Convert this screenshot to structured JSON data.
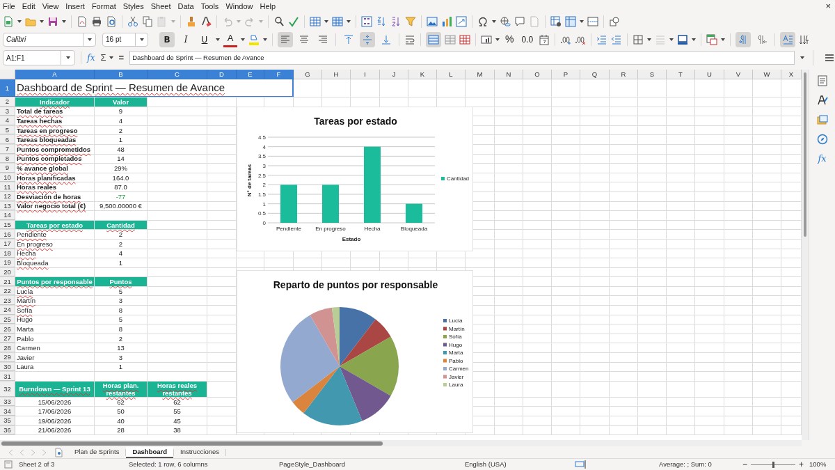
{
  "menu": {
    "items": [
      "File",
      "Edit",
      "View",
      "Insert",
      "Format",
      "Styles",
      "Sheet",
      "Data",
      "Tools",
      "Window",
      "Help"
    ],
    "close_label": "×"
  },
  "toolbar": {
    "disabled": {
      "paste": true,
      "undo": true,
      "redo": true,
      "header_footer": true
    }
  },
  "format_toolbar": {
    "font_name": "Calibri",
    "font_size": "16 pt",
    "buttons": [
      {
        "label": "B",
        "on": true
      },
      {
        "label": "I",
        "on": false
      },
      {
        "label": "U",
        "on": false
      }
    ],
    "font_color_label": "A",
    "number_labels": [
      "%",
      "0.0"
    ],
    "horizontal_align": {
      "left": true,
      "center": false,
      "right": false
    },
    "vertical_align": {
      "top": false,
      "middle": true,
      "bottom": false
    },
    "merged": true,
    "left_to_right": true,
    "right_to_left": false,
    "text_flow": true
  },
  "formula_bar": {
    "name_box": "A1:F1",
    "buttons": [
      "fx",
      "Σ",
      "="
    ],
    "content": "Dashboard de Sprint — Resumen de Avance"
  },
  "sidebar": {
    "functions_label": "fx"
  },
  "columns": [
    {
      "label": "A",
      "selected": true
    },
    {
      "label": "B",
      "selected": true
    },
    {
      "label": "C",
      "selected": true
    },
    {
      "label": "D",
      "selected": true
    },
    {
      "label": "E",
      "selected": true
    },
    {
      "label": "F",
      "selected": true
    },
    {
      "label": "G",
      "selected": false
    },
    {
      "label": "H",
      "selected": false
    },
    {
      "label": "I",
      "selected": false
    },
    {
      "label": "J",
      "selected": false
    },
    {
      "label": "K",
      "selected": false
    },
    {
      "label": "L",
      "selected": false
    },
    {
      "label": "M",
      "selected": false
    },
    {
      "label": "N",
      "selected": false
    },
    {
      "label": "O",
      "selected": false
    },
    {
      "label": "P",
      "selected": false
    },
    {
      "label": "Q",
      "selected": false
    },
    {
      "label": "R",
      "selected": false
    },
    {
      "label": "S",
      "selected": false
    },
    {
      "label": "T",
      "selected": false
    },
    {
      "label": "U",
      "selected": false
    },
    {
      "label": "V",
      "selected": false
    },
    {
      "label": "W",
      "selected": false
    },
    {
      "label": "X",
      "selected": false
    }
  ],
  "rows": [
    {
      "number": "1",
      "selected": true,
      "cells": [
        {
          "text": "Dashboard de Sprint — Resumen de Avance",
          "kind": "title",
          "misspelled": true
        }
      ]
    },
    {
      "number": "2",
      "selected": false,
      "cells": [
        {
          "text": "Indicador",
          "kind": "header",
          "misspelled": true
        },
        {
          "text": "Valor",
          "kind": "header",
          "misspelled": false
        }
      ]
    },
    {
      "number": "3",
      "selected": false,
      "cells": [
        {
          "text": "Total de tareas",
          "kind": "strong",
          "misspelled": true
        },
        {
          "text": "9",
          "kind": "value",
          "misspelled": false
        }
      ]
    },
    {
      "number": "4",
      "selected": false,
      "cells": [
        {
          "text": "Tareas hechas",
          "kind": "strong",
          "misspelled": true
        },
        {
          "text": "4",
          "kind": "value",
          "misspelled": false
        }
      ]
    },
    {
      "number": "5",
      "selected": false,
      "cells": [
        {
          "text": "Tareas en progreso",
          "kind": "strong",
          "misspelled": true
        },
        {
          "text": "2",
          "kind": "value",
          "misspelled": false
        }
      ]
    },
    {
      "number": "6",
      "selected": false,
      "cells": [
        {
          "text": "Tareas bloqueadas",
          "kind": "strong",
          "misspelled": true
        },
        {
          "text": "1",
          "kind": "value",
          "misspelled": false
        }
      ]
    },
    {
      "number": "7",
      "selected": false,
      "cells": [
        {
          "text": "Puntos comprometidos",
          "kind": "strong",
          "misspelled": true
        },
        {
          "text": "48",
          "kind": "value",
          "misspelled": false
        }
      ]
    },
    {
      "number": "8",
      "selected": false,
      "cells": [
        {
          "text": "Puntos completados",
          "kind": "strong",
          "misspelled": true
        },
        {
          "text": "14",
          "kind": "value",
          "misspelled": false
        }
      ]
    },
    {
      "number": "9",
      "selected": false,
      "cells": [
        {
          "text": "% avance global",
          "kind": "strong",
          "misspelled": true
        },
        {
          "text": "29%",
          "kind": "value",
          "misspelled": false
        }
      ]
    },
    {
      "number": "10",
      "selected": false,
      "cells": [
        {
          "text": "Horas planificadas",
          "kind": "strong",
          "misspelled": true
        },
        {
          "text": "164.0",
          "kind": "value",
          "misspelled": false
        }
      ]
    },
    {
      "number": "11",
      "selected": false,
      "cells": [
        {
          "text": "Horas reales",
          "kind": "strong",
          "misspelled": true
        },
        {
          "text": "87.0",
          "kind": "value",
          "misspelled": false
        }
      ]
    },
    {
      "number": "12",
      "selected": false,
      "cells": [
        {
          "text": "Desviación de horas",
          "kind": "strong",
          "misspelled": true
        },
        {
          "text": "-77",
          "kind": "good",
          "misspelled": false
        }
      ]
    },
    {
      "number": "13",
      "selected": false,
      "cells": [
        {
          "text": "Valor negocio total (€)",
          "kind": "strong",
          "misspelled": true
        },
        {
          "text": "9,500.00000 €",
          "kind": "value",
          "misspelled": false
        }
      ]
    },
    {
      "number": "14",
      "selected": false,
      "cells": []
    },
    {
      "number": "15",
      "selected": false,
      "cells": [
        {
          "text": "Tareas por estado",
          "kind": "header",
          "misspelled": true
        },
        {
          "text": "Cantidad",
          "kind": "header",
          "misspelled": true
        }
      ]
    },
    {
      "number": "16",
      "selected": false,
      "cells": [
        {
          "text": "Pendiente",
          "kind": "label",
          "misspelled": true
        },
        {
          "text": "2",
          "kind": "value",
          "misspelled": false
        }
      ]
    },
    {
      "number": "17",
      "selected": false,
      "cells": [
        {
          "text": "En progreso",
          "kind": "label",
          "misspelled": true
        },
        {
          "text": "2",
          "kind": "value",
          "misspelled": false
        }
      ]
    },
    {
      "number": "18",
      "selected": false,
      "cells": [
        {
          "text": "Hecha",
          "kind": "label",
          "misspelled": true
        },
        {
          "text": "4",
          "kind": "value",
          "misspelled": false
        }
      ]
    },
    {
      "number": "19",
      "selected": false,
      "cells": [
        {
          "text": "Bloqueada",
          "kind": "label",
          "misspelled": true
        },
        {
          "text": "1",
          "kind": "value",
          "misspelled": false
        }
      ]
    },
    {
      "number": "20",
      "selected": false,
      "cells": []
    },
    {
      "number": "21",
      "selected": false,
      "cells": [
        {
          "text": "Puntos por responsable",
          "kind": "header",
          "misspelled": true
        },
        {
          "text": "Puntos",
          "kind": "header",
          "misspelled": true
        }
      ]
    },
    {
      "number": "22",
      "selected": false,
      "cells": [
        {
          "text": "Lucía",
          "kind": "label",
          "misspelled": true
        },
        {
          "text": "5",
          "kind": "value",
          "misspelled": false
        }
      ]
    },
    {
      "number": "23",
      "selected": false,
      "cells": [
        {
          "text": "Martín",
          "kind": "label",
          "misspelled": true
        },
        {
          "text": "3",
          "kind": "value",
          "misspelled": false
        }
      ]
    },
    {
      "number": "24",
      "selected": false,
      "cells": [
        {
          "text": "Sofía",
          "kind": "label",
          "misspelled": true
        },
        {
          "text": "8",
          "kind": "value",
          "misspelled": false
        }
      ]
    },
    {
      "number": "25",
      "selected": false,
      "cells": [
        {
          "text": "Hugo",
          "kind": "label",
          "misspelled": false
        },
        {
          "text": "5",
          "kind": "value",
          "misspelled": false
        }
      ]
    },
    {
      "number": "26",
      "selected": false,
      "cells": [
        {
          "text": "Marta",
          "kind": "label",
          "misspelled": false
        },
        {
          "text": "8",
          "kind": "value",
          "misspelled": false
        }
      ]
    },
    {
      "number": "27",
      "selected": false,
      "cells": [
        {
          "text": "Pablo",
          "kind": "label",
          "misspelled": false
        },
        {
          "text": "2",
          "kind": "value",
          "misspelled": false
        }
      ]
    },
    {
      "number": "28",
      "selected": false,
      "cells": [
        {
          "text": "Carmen",
          "kind": "label",
          "misspelled": false
        },
        {
          "text": "13",
          "kind": "value",
          "misspelled": false
        }
      ]
    },
    {
      "number": "29",
      "selected": false,
      "cells": [
        {
          "text": "Javier",
          "kind": "label",
          "misspelled": false
        },
        {
          "text": "3",
          "kind": "value",
          "misspelled": false
        }
      ]
    },
    {
      "number": "30",
      "selected": false,
      "cells": [
        {
          "text": "Laura",
          "kind": "label",
          "misspelled": false
        },
        {
          "text": "1",
          "kind": "value",
          "misspelled": false
        }
      ]
    },
    {
      "number": "31",
      "selected": false,
      "cells": []
    },
    {
      "number": "32",
      "selected": false,
      "cells": [
        {
          "text": "Burndown — Sprint 13",
          "kind": "header",
          "misspelled": true
        },
        {
          "text": "Horas plan. restantes",
          "kind": "header",
          "misspelled": true
        },
        {
          "text": "Horas reales restantes",
          "kind": "header",
          "misspelled": true
        }
      ]
    },
    {
      "number": "33",
      "selected": false,
      "cells": [
        {
          "text": "15/06/2026",
          "kind": "value",
          "misspelled": false
        },
        {
          "text": "62",
          "kind": "value",
          "misspelled": false
        },
        {
          "text": "62",
          "kind": "value",
          "misspelled": false
        }
      ]
    },
    {
      "number": "34",
      "selected": false,
      "cells": [
        {
          "text": "17/06/2026",
          "kind": "value",
          "misspelled": false
        },
        {
          "text": "50",
          "kind": "value",
          "misspelled": false
        },
        {
          "text": "55",
          "kind": "value",
          "misspelled": false
        }
      ]
    },
    {
      "number": "35",
      "selected": false,
      "cells": [
        {
          "text": "19/06/2026",
          "kind": "value",
          "misspelled": false
        },
        {
          "text": "40",
          "kind": "value",
          "misspelled": false
        },
        {
          "text": "45",
          "kind": "value",
          "misspelled": false
        }
      ]
    },
    {
      "number": "36",
      "selected": false,
      "cells": [
        {
          "text": "21/06/2026",
          "kind": "value",
          "misspelled": false
        },
        {
          "text": "28",
          "kind": "value",
          "misspelled": false
        },
        {
          "text": "38",
          "kind": "value",
          "misspelled": false
        }
      ]
    }
  ],
  "charts": [
    {
      "chart_data": {
        "type": "bar",
        "title": "Tareas por estado",
        "xlabel": "Estado",
        "ylabel": "N° de tareas",
        "categories": [
          "Pendiente",
          "En progreso",
          "Hecha",
          "Bloqueada"
        ],
        "series": [
          {
            "name": "Cantidad",
            "color": "#1abc9c",
            "values": [
              2,
              2,
              4,
              1
            ]
          }
        ],
        "ylim": [
          0,
          4.5
        ],
        "yticks": [
          0,
          0.5,
          1,
          1.5,
          2,
          2.5,
          3,
          3.5,
          4,
          4.5
        ],
        "grid": true,
        "legend": "right"
      }
    },
    {
      "chart_data": {
        "type": "pie",
        "title": "Reparto de puntos por responsable",
        "categories": [
          "Lucía",
          "Martín",
          "Sofía",
          "Hugo",
          "Marta",
          "Pablo",
          "Carmen",
          "Javier",
          "Laura"
        ],
        "series": [
          {
            "values": [
              10.42,
              6.25,
              16.67,
              10.42,
              16.67,
              4.17,
              27.07,
              6.25,
              2.08
            ]
          }
        ],
        "legend": "right",
        "colors": [
          "#4672a8",
          "#aa4643",
          "#89a54e",
          "#71588f",
          "#4198af",
          "#db843d",
          "#93a9cf",
          "#d19392",
          "#b9cd96"
        ]
      }
    }
  ],
  "sheet_tabs": [
    {
      "label": "Plan de Sprints",
      "selected": false
    },
    {
      "label": "Dashboard",
      "selected": true
    },
    {
      "label": "Instrucciones",
      "selected": false
    }
  ],
  "status_bar": {
    "sheet": "Sheet 2 of 3",
    "selection": "Selected: 1 row, 6 columns",
    "page_style": "PageStyle_Dashboard",
    "language": "English (USA)",
    "summary": "Average: ; Sum: 0",
    "zoom_out_label": "−",
    "zoom_slider": {
      "level": 0.5
    },
    "zoom_in_label": "+",
    "zoom": "100%"
  }
}
